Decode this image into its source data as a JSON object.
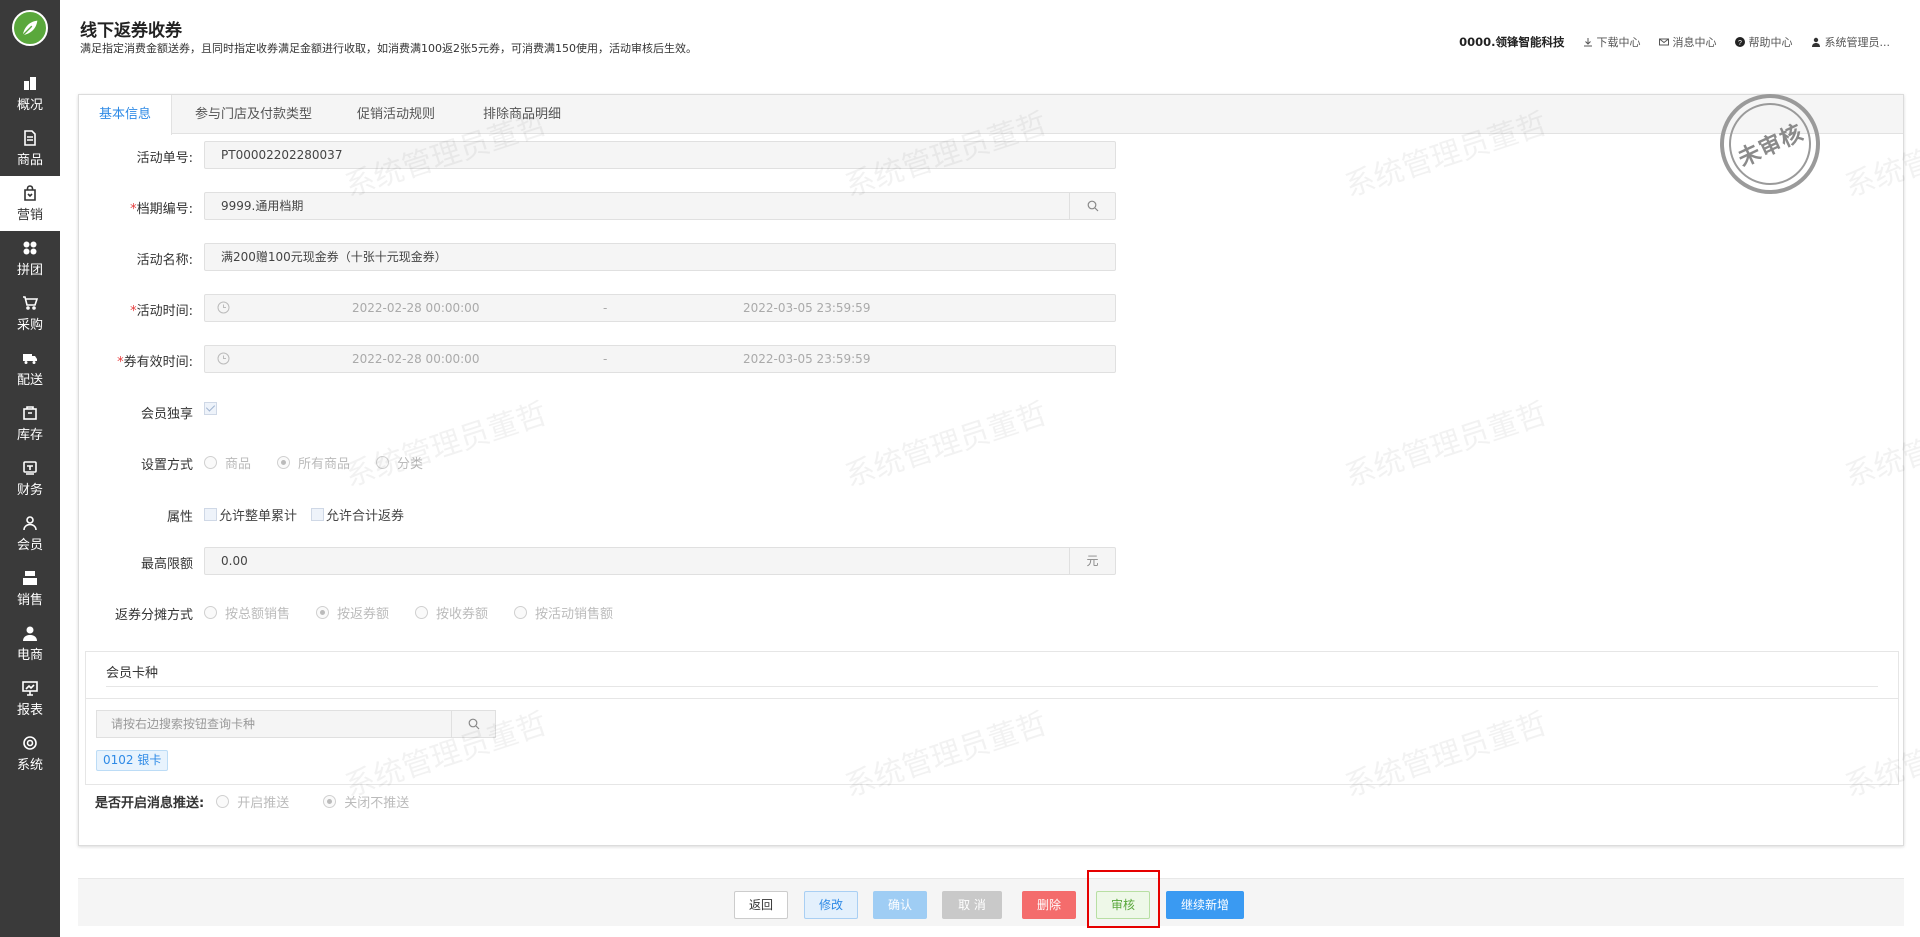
{
  "nav": [
    {
      "label": "概况",
      "icon": "building-icon"
    },
    {
      "label": "商品",
      "icon": "document-icon"
    },
    {
      "label": "营销",
      "icon": "bag-icon",
      "active": true
    },
    {
      "label": "拼团",
      "icon": "grid-icon"
    },
    {
      "label": "采购",
      "icon": "cart-icon"
    },
    {
      "label": "配送",
      "icon": "truck-icon"
    },
    {
      "label": "库存",
      "icon": "box-icon"
    },
    {
      "label": "财务",
      "icon": "finance-icon"
    },
    {
      "label": "会员",
      "icon": "user-icon"
    },
    {
      "label": "销售",
      "icon": "register-icon"
    },
    {
      "label": "电商",
      "icon": "person-icon"
    },
    {
      "label": "报表",
      "icon": "chart-board-icon"
    },
    {
      "label": "系统",
      "icon": "gear-icon"
    }
  ],
  "header": {
    "title": "线下返券收券",
    "subtitle": "满足指定消费金额送券，且同时指定收券满足金额进行收取，如消费满100返2张5元券，可消费满150使用，活动审核后生效。",
    "org": "0000.领锋智能科技",
    "download": "下载中心",
    "messages": "消息中心",
    "help": "帮助中心",
    "user": "系统管理员..."
  },
  "tabs": [
    "基本信息",
    "参与门店及付款类型",
    "促销活动规则",
    "排除商品明细"
  ],
  "form": {
    "order_no_label": "活动单号:",
    "order_no": "PT00002202280037",
    "period_label": "档期编号:",
    "period": "9999.通用档期",
    "name_label": "活动名称:",
    "name": "满200赠100元现金券（十张十元现金券）",
    "time_label": "活动时间:",
    "time_start": "2022-02-28 00:00:00",
    "time_sep": "-",
    "time_end": "2022-03-05 23:59:59",
    "valid_label": "券有效时间:",
    "valid_start": "2022-02-28 00:00:00",
    "valid_sep": "-",
    "valid_end": "2022-03-05 23:59:59",
    "member_label": "会员独享",
    "setting_label": "设置方式",
    "setting_opts": [
      "商品",
      "所有商品",
      "分类"
    ],
    "attr_label": "属性",
    "attr_opts": [
      "允许整单累计",
      "允许合计返券"
    ],
    "max_label": "最高限额",
    "max_value": "0.00",
    "max_unit": "元",
    "split_label": "返券分摊方式",
    "split_opts": [
      "按总额销售",
      "按返券额",
      "按收券额",
      "按活动销售额"
    ]
  },
  "card": {
    "title": "会员卡种",
    "search_placeholder": "请按右边搜索按钮查询卡种",
    "tag": "0102 银卡"
  },
  "push": {
    "label": "是否开启消息推送:",
    "opts": [
      "开启推送",
      "关闭不推送"
    ]
  },
  "stamp": "未审核",
  "watermark": "系统管理员董哲",
  "buttons": {
    "return": "返回",
    "edit": "修改",
    "confirm": "确认",
    "cancel": "取 消",
    "delete": "删除",
    "audit": "审核",
    "next": "继续新增"
  }
}
